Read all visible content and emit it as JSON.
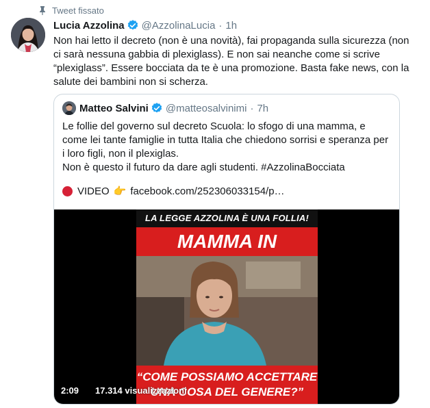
{
  "pinned": {
    "label": "Tweet fissato"
  },
  "tweet": {
    "name": "Lucia Azzolina",
    "handle": "@AzzolinaLucia",
    "separator": "·",
    "time": "1h",
    "text": "Non hai letto il decreto (non è una novità), fai propaganda sulla sicurezza (non ci sarà nessuna gabbia di plexiglass). E non sai neanche come si scrive “plexiglass”. Essere bocciata da te è una promozione. Basta fake news, con la salute dei bambini non si scherza."
  },
  "quoted": {
    "name": "Matteo Salvini",
    "handle": "@matteosalvinimi",
    "separator": "·",
    "time": "7h",
    "text_line1": "Le follie del governo sul decreto Scuola: lo sfogo di una mamma, e come lei tante famiglie in tutta Italia che chiedono sorrisi e speranza per i loro figli, non il plexiglas.",
    "text_line2": "Non è questo il futuro da dare agli studenti. #AzzolinaBocciata",
    "video_label": "VIDEO",
    "link": "facebook.com/252306033154/p…"
  },
  "media": {
    "banner_top": "LA LEGGE AZZOLINA È UNA FOLLIA!",
    "banner_main": "MAMMA IN LACRIME",
    "banner_bottom_line1": "“COME POSSIAMO ACCETTARE",
    "banner_bottom_line2": "UNA COSA DEL GENERE?”",
    "duration": "2:09",
    "views": "17.314 visualizzazioni"
  },
  "colors": {
    "verified": "#1da1f2",
    "secondary_text": "#657786",
    "border": "#ccd6dd",
    "banner_red": "#d81e1e"
  },
  "icons": {
    "pin": "pin-icon",
    "verified": "verified-badge-icon",
    "red_circle": "red-circle-icon",
    "pointing_hand": "pointing-right-hand-icon"
  }
}
